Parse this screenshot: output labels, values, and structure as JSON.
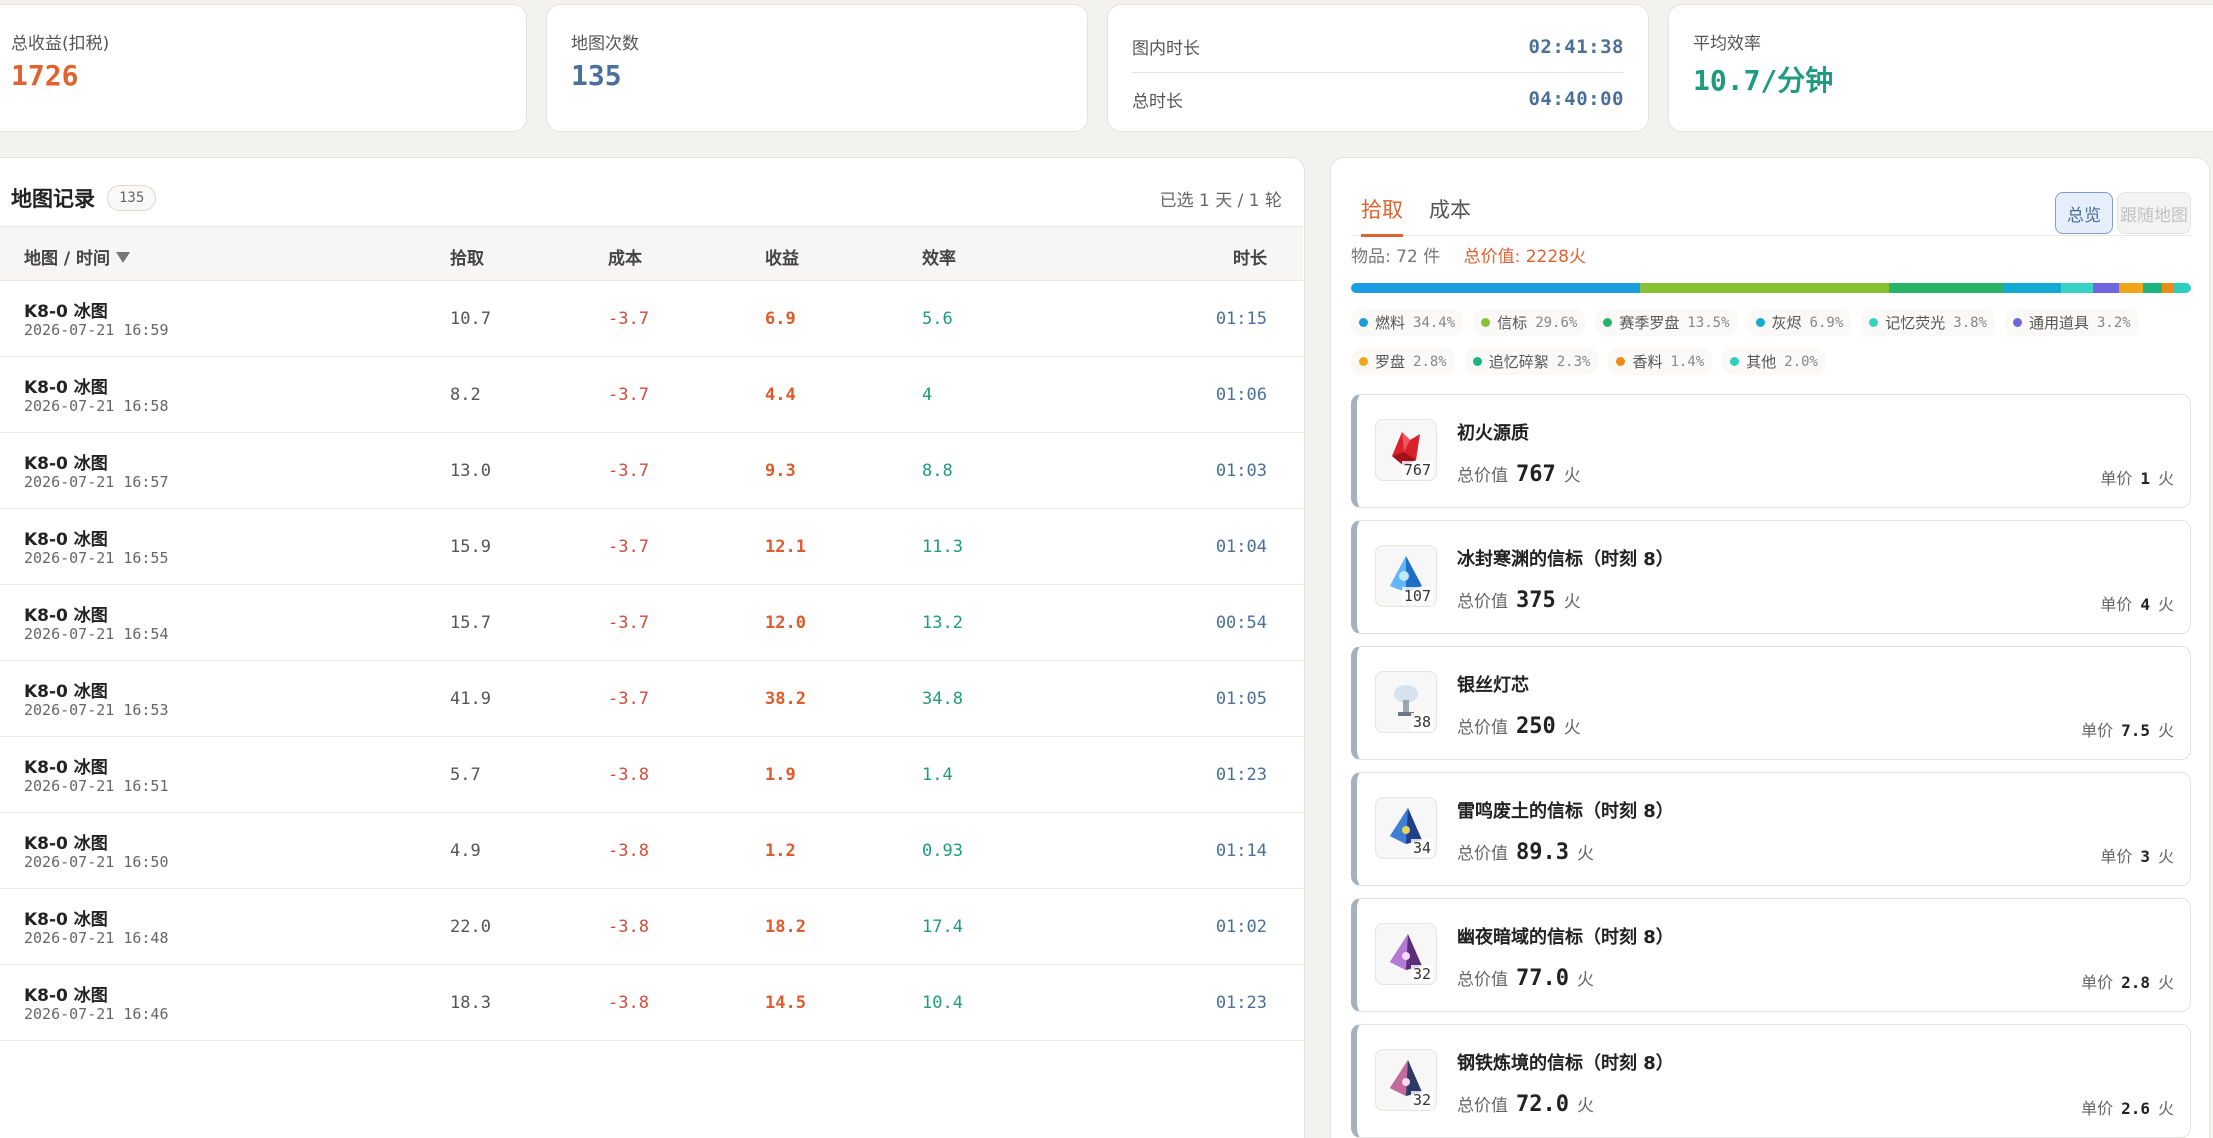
{
  "stats": {
    "income_label": "总收益(扣税)",
    "income_value": "1726",
    "maps_label": "地图次数",
    "maps_value": "135",
    "in_map_label": "图内时长",
    "in_map_value": "02:41:38",
    "total_time_label": "总时长",
    "total_time_value": "04:40:00",
    "avg_eff_label": "平均效率",
    "avg_eff_value": "10.7/分钟"
  },
  "colors": {
    "income": "#e0622e",
    "maps": "#4a6f99",
    "efficiency": "#1f9b82"
  },
  "records": {
    "title": "地图记录",
    "count": "135",
    "selected_info": "已选 1 天 / 1 轮",
    "headers": {
      "map_time": "地图 / 时间",
      "pickup": "拾取",
      "cost": "成本",
      "profit": "收益",
      "efficiency": "效率",
      "duration": "时长"
    },
    "rows": [
      {
        "map": "K8-0 冰图",
        "time": "2026-07-21 16:59",
        "pickup": "10.7",
        "cost": "-3.7",
        "profit": "6.9",
        "eff": "5.6",
        "dur": "01:15"
      },
      {
        "map": "K8-0 冰图",
        "time": "2026-07-21 16:58",
        "pickup": "8.2",
        "cost": "-3.7",
        "profit": "4.4",
        "eff": "4",
        "dur": "01:06"
      },
      {
        "map": "K8-0 冰图",
        "time": "2026-07-21 16:57",
        "pickup": "13.0",
        "cost": "-3.7",
        "profit": "9.3",
        "eff": "8.8",
        "dur": "01:03"
      },
      {
        "map": "K8-0 冰图",
        "time": "2026-07-21 16:55",
        "pickup": "15.9",
        "cost": "-3.7",
        "profit": "12.1",
        "eff": "11.3",
        "dur": "01:04"
      },
      {
        "map": "K8-0 冰图",
        "time": "2026-07-21 16:54",
        "pickup": "15.7",
        "cost": "-3.7",
        "profit": "12.0",
        "eff": "13.2",
        "dur": "00:54"
      },
      {
        "map": "K8-0 冰图",
        "time": "2026-07-21 16:53",
        "pickup": "41.9",
        "cost": "-3.7",
        "profit": "38.2",
        "eff": "34.8",
        "dur": "01:05"
      },
      {
        "map": "K8-0 冰图",
        "time": "2026-07-21 16:51",
        "pickup": "5.7",
        "cost": "-3.8",
        "profit": "1.9",
        "eff": "1.4",
        "dur": "01:23"
      },
      {
        "map": "K8-0 冰图",
        "time": "2026-07-21 16:50",
        "pickup": "4.9",
        "cost": "-3.8",
        "profit": "1.2",
        "eff": "0.93",
        "dur": "01:14"
      },
      {
        "map": "K8-0 冰图",
        "time": "2026-07-21 16:48",
        "pickup": "22.0",
        "cost": "-3.8",
        "profit": "18.2",
        "eff": "17.4",
        "dur": "01:02"
      },
      {
        "map": "K8-0 冰图",
        "time": "2026-07-21 16:46",
        "pickup": "18.3",
        "cost": "-3.8",
        "profit": "14.5",
        "eff": "10.4",
        "dur": "01:23"
      }
    ]
  },
  "items_panel": {
    "tab_pickup": "拾取",
    "tab_cost": "成本",
    "btn_overview": "总览",
    "btn_follow": "跟随地图",
    "item_count": "物品: 72 件",
    "total_value": "总价值: 2228火",
    "categories": [
      {
        "name": "燃料",
        "pct": "34.4%",
        "value": 34.4,
        "color": "#1a9de0"
      },
      {
        "name": "信标",
        "pct": "29.6%",
        "value": 29.6,
        "color": "#86c232"
      },
      {
        "name": "赛季罗盘",
        "pct": "13.5%",
        "value": 13.5,
        "color": "#27b567"
      },
      {
        "name": "灰烬",
        "pct": "6.9%",
        "value": 6.9,
        "color": "#13a9d1"
      },
      {
        "name": "记忆荧光",
        "pct": "3.8%",
        "value": 3.8,
        "color": "#38d2c4"
      },
      {
        "name": "通用道具",
        "pct": "3.2%",
        "value": 3.2,
        "color": "#6f67e0"
      },
      {
        "name": "罗盘",
        "pct": "2.8%",
        "value": 2.8,
        "color": "#f0a61a"
      },
      {
        "name": "追忆碎絮",
        "pct": "2.3%",
        "value": 2.3,
        "color": "#1ab57a"
      },
      {
        "name": "香料",
        "pct": "1.4%",
        "value": 1.4,
        "color": "#f08a14"
      },
      {
        "name": "其他",
        "pct": "2.0%",
        "value": 2.0,
        "color": "#2fcfc0"
      }
    ],
    "total_label": "总价值",
    "unit_label": "单价",
    "currency": "火",
    "items": [
      {
        "name": "初火源质",
        "qty": "767",
        "total": "767",
        "unit": "1",
        "icon": "red-crystal-icon"
      },
      {
        "name": "冰封寒渊的信标（时刻 8）",
        "qty": "107",
        "total": "375",
        "unit": "4",
        "icon": "blue-beacon-icon"
      },
      {
        "name": "银丝灯芯",
        "qty": "38",
        "total": "250",
        "unit": "7.5",
        "icon": "silver-wick-icon"
      },
      {
        "name": "雷鸣废土的信标（时刻 8）",
        "qty": "34",
        "total": "89.3",
        "unit": "3",
        "icon": "thunder-beacon-icon"
      },
      {
        "name": "幽夜暗域的信标（时刻 8）",
        "qty": "32",
        "total": "77.0",
        "unit": "2.8",
        "icon": "purple-beacon-icon"
      },
      {
        "name": "钢铁炼境的信标（时刻 8）",
        "qty": "32",
        "total": "72.0",
        "unit": "2.6",
        "icon": "steel-beacon-icon"
      }
    ]
  }
}
